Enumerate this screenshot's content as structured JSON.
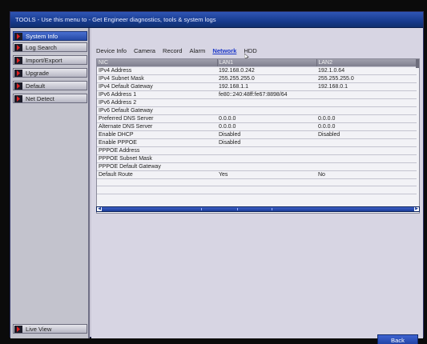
{
  "window": {
    "title": "TOOLS - Use this menu to - Get Engineer diagnostics, tools & system logs"
  },
  "sidebar": {
    "items": [
      {
        "label": "System Info",
        "active": true
      },
      {
        "label": "Log Search",
        "active": false
      },
      {
        "label": "Import/Export",
        "active": false
      },
      {
        "label": "Upgrade",
        "active": false
      },
      {
        "label": "Default",
        "active": false
      },
      {
        "label": "Net Detect",
        "active": false
      }
    ],
    "bottom": {
      "label": "Live View"
    }
  },
  "tabs": [
    {
      "label": "Device Info",
      "active": false
    },
    {
      "label": "Camera",
      "active": false
    },
    {
      "label": "Record",
      "active": false
    },
    {
      "label": "Alarm",
      "active": false
    },
    {
      "label": "Network",
      "active": true
    },
    {
      "label": "HDD",
      "active": false
    }
  ],
  "table": {
    "headers": [
      "NIC",
      "LAN1",
      "LAN2"
    ],
    "rows": [
      [
        "IPv4 Address",
        "192.168.0.242",
        "192.1.0.64"
      ],
      [
        "IPv4 Subnet Mask",
        "255.255.255.0",
        "255.255.255.0"
      ],
      [
        "IPv4 Default Gateway",
        "192.168.1.1",
        "192.168.0.1"
      ],
      [
        "IPv6 Address 1",
        "fe80::240:48ff:fe67:8898/64",
        ""
      ],
      [
        "IPv6 Address 2",
        "",
        ""
      ],
      [
        "IPv6 Default Gateway",
        "",
        ""
      ],
      [
        "Preferred DNS Server",
        "0.0.0.0",
        "0.0.0.0"
      ],
      [
        "Alternate DNS Server",
        "0.0.0.0",
        "0.0.0.0"
      ],
      [
        "Enable DHCP",
        "Disabled",
        "Disabled"
      ],
      [
        "Enable PPPOE",
        "Disabled",
        ""
      ],
      [
        "PPPOE Address",
        "",
        ""
      ],
      [
        "PPPOE Subnet Mask",
        "",
        ""
      ],
      [
        "PPPOE Default Gateway",
        "",
        ""
      ],
      [
        "Default Route",
        "Yes",
        "No"
      ]
    ]
  },
  "buttons": {
    "back": "Back"
  },
  "colors": {
    "accent": "#1d3e9e",
    "active_tab": "#1a36c9",
    "panel": "#d7d5e3"
  }
}
